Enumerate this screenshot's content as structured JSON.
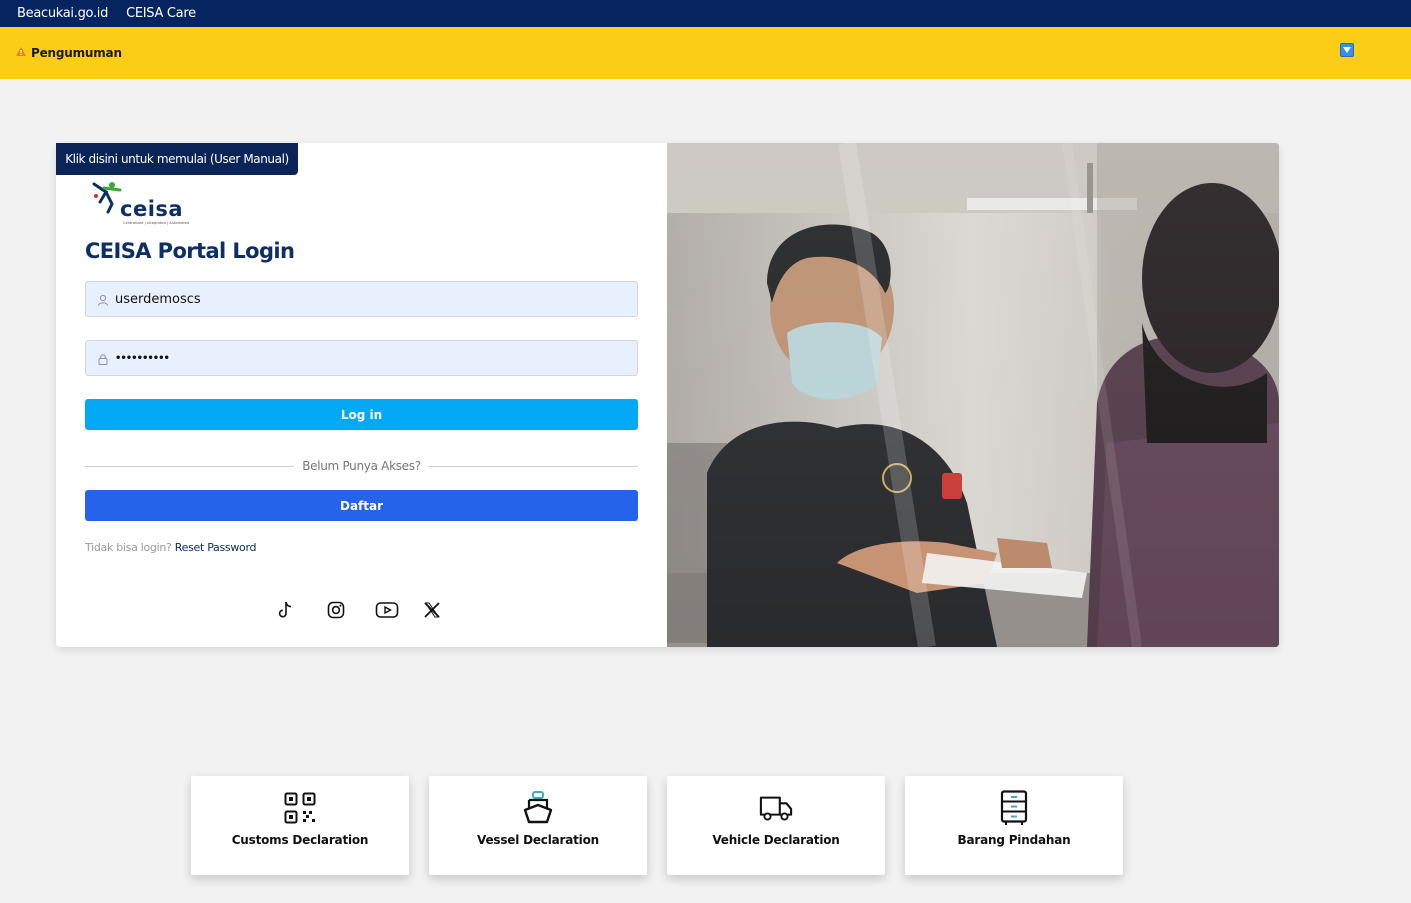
{
  "topbar": {
    "links": [
      "Beacukai.go.id",
      "CEISA Care"
    ]
  },
  "announcement": {
    "label": "Pengumuman",
    "warning_icon": "warning-icon",
    "toggle_icon": "chevron-down-icon"
  },
  "login": {
    "manual_tab": "Klik disini untuk memulai (User Manual)",
    "logo_text": "ceisa",
    "logo_tagline": "Centralized | Integrated | Automated",
    "title": "CEISA Portal Login",
    "username_value": "userdemoscs",
    "password_value": "••••••••••",
    "login_label": "Log in",
    "divider_text": "Belum Punya Akses?",
    "register_label": "Daftar",
    "reset_prefix": "Tidak bisa login?",
    "reset_link": "Reset Password",
    "social": [
      "tiktok-icon",
      "instagram-icon",
      "youtube-icon",
      "x-icon"
    ]
  },
  "colors": {
    "navy": "#06245f",
    "yellow": "#fbcd17",
    "login_button": "#03a9f4",
    "register_button": "#2563eb"
  },
  "services": [
    {
      "label": "Customs Declaration",
      "icon": "qr-code-icon"
    },
    {
      "label": "Vessel Declaration",
      "icon": "ship-icon"
    },
    {
      "label": "Vehicle Declaration",
      "icon": "truck-icon"
    },
    {
      "label": "Barang Pindahan",
      "icon": "cabinet-icon"
    }
  ]
}
